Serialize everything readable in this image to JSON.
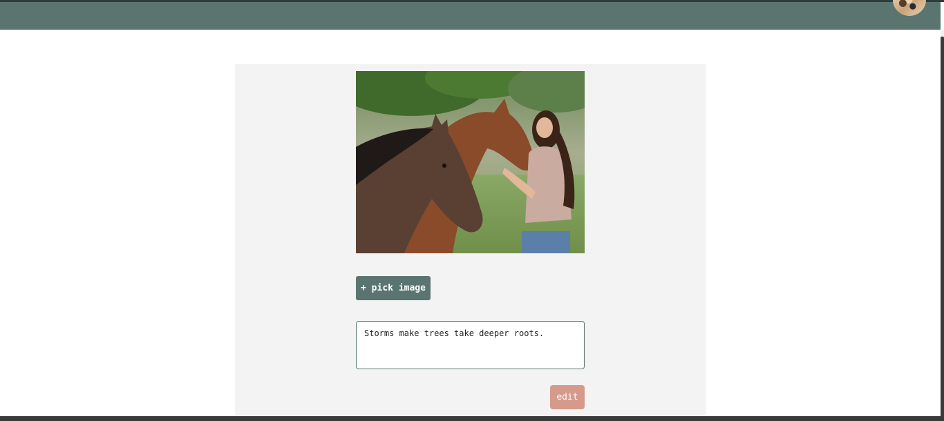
{
  "header": {
    "avatar_icon": "user-avatar-icon",
    "color": "#5a7570"
  },
  "editor": {
    "image_icon": "photo-woman-with-horses",
    "pick_image_label": "+ pick image",
    "caption_value": "Storms make trees take deeper roots.",
    "edit_label": "edit"
  },
  "colors": {
    "primary": "#5a7570",
    "accent": "#d59a8a",
    "panel": "#f3f3f3"
  }
}
